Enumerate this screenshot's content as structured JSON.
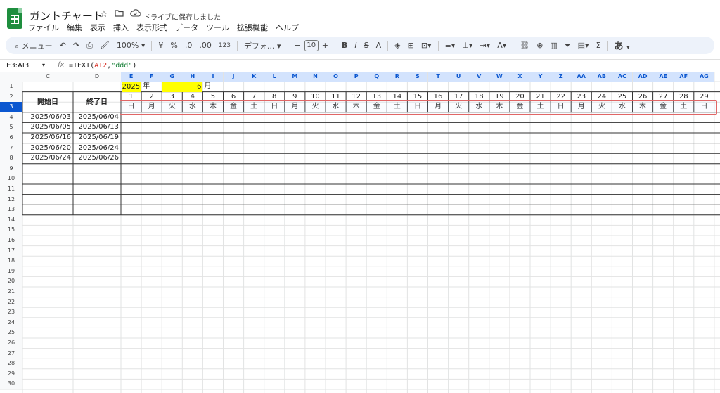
{
  "doc": {
    "title": "ガントチャート",
    "save_status": "ドライブに保存しました"
  },
  "icons": {
    "star": "star-icon",
    "folder": "move-folder-icon",
    "cloud": "cloud-check-icon"
  },
  "menu": [
    "ファイル",
    "編集",
    "表示",
    "挿入",
    "表示形式",
    "データ",
    "ツール",
    "拡張機能",
    "ヘルプ"
  ],
  "toolbar": {
    "search": "メニュー",
    "zoom": "100%",
    "currency": "¥",
    "percent": "%",
    "dec_decrease": ".0",
    "dec_increase": ".00",
    "number_format": "123",
    "font": "デフォ...",
    "font_size": "10",
    "input_tool": "あ"
  },
  "formula_bar": {
    "name_box": "E3:AI3",
    "fx": "fx",
    "formula": "=TEXT(AI2,\"ddd\")"
  },
  "colors": {
    "highlight": "#ffff00",
    "selection_header": "#d3e3fd",
    "selected_row_header": "#0b57d0",
    "range_border": "#e06666"
  },
  "columns": [
    "C",
    "D",
    "E",
    "F",
    "G",
    "H",
    "I",
    "J",
    "K",
    "L",
    "M",
    "N",
    "O",
    "P",
    "Q",
    "R",
    "S",
    "T",
    "U",
    "V",
    "W",
    "X",
    "Y",
    "Z",
    "AA",
    "AB",
    "AC",
    "AD",
    "AE",
    "AF",
    "AG"
  ],
  "rows": [
    "1",
    "2",
    "3",
    "4",
    "5",
    "6",
    "7",
    "8",
    "9",
    "10",
    "11",
    "12",
    "13",
    "14",
    "15",
    "16",
    "17",
    "18",
    "19",
    "20",
    "21",
    "22",
    "23",
    "24",
    "25",
    "26",
    "27",
    "28",
    "29",
    "30"
  ],
  "sheet": {
    "year": "2025",
    "year_label": "年",
    "month": "6",
    "month_label": "月",
    "header_start": "開始日",
    "header_end": "終了日",
    "days": [
      "1",
      "2",
      "3",
      "4",
      "5",
      "6",
      "7",
      "8",
      "9",
      "10",
      "11",
      "12",
      "13",
      "14",
      "15",
      "16",
      "17",
      "18",
      "19",
      "20",
      "21",
      "22",
      "23",
      "24",
      "25",
      "26",
      "27",
      "28",
      "29"
    ],
    "weekdays": [
      "日",
      "月",
      "火",
      "水",
      "木",
      "金",
      "土",
      "日",
      "月",
      "火",
      "水",
      "木",
      "金",
      "土",
      "日",
      "月",
      "火",
      "水",
      "木",
      "金",
      "土",
      "日",
      "月",
      "火",
      "水",
      "木",
      "金",
      "土",
      "日"
    ],
    "tasks": [
      {
        "start": "2025/06/03",
        "end": "2025/06/04"
      },
      {
        "start": "2025/06/05",
        "end": "2025/06/13"
      },
      {
        "start": "2025/06/16",
        "end": "2025/06/19"
      },
      {
        "start": "2025/06/20",
        "end": "2025/06/24"
      },
      {
        "start": "2025/06/24",
        "end": "2025/06/26"
      }
    ]
  }
}
